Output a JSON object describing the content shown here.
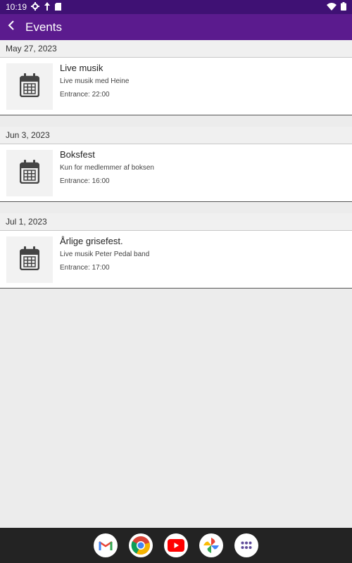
{
  "status_bar": {
    "time": "10:19",
    "icons_left": [
      "settings-icon",
      "pin-icon",
      "sd-card-icon"
    ],
    "icons_right": [
      "wifi-icon",
      "battery-icon"
    ]
  },
  "app_bar": {
    "title": "Events",
    "back_icon": "chevron-left-icon"
  },
  "events": [
    {
      "date": "May 27, 2023",
      "title": "Live musik",
      "description": "Live musik med Heine",
      "entrance": "Entrance: 22:00",
      "icon": "calendar-icon"
    },
    {
      "date": "Jun 3, 2023",
      "title": "Boksfest",
      "description": "Kun for medlemmer af boksen",
      "entrance": "Entrance: 16:00",
      "icon": "calendar-icon"
    },
    {
      "date": "Jul 1, 2023",
      "title": "Årlige grisefest.",
      "description": "Live musik Peter Pedal band",
      "entrance": "Entrance: 17:00",
      "icon": "calendar-icon"
    }
  ],
  "dock": [
    "gmail-icon",
    "chrome-icon",
    "youtube-icon",
    "photos-icon",
    "app-drawer-icon"
  ],
  "colors": {
    "status_bar": "#3f1174",
    "app_bar": "#5b1b8e",
    "background": "#ececec",
    "nav_bar": "#232323"
  }
}
